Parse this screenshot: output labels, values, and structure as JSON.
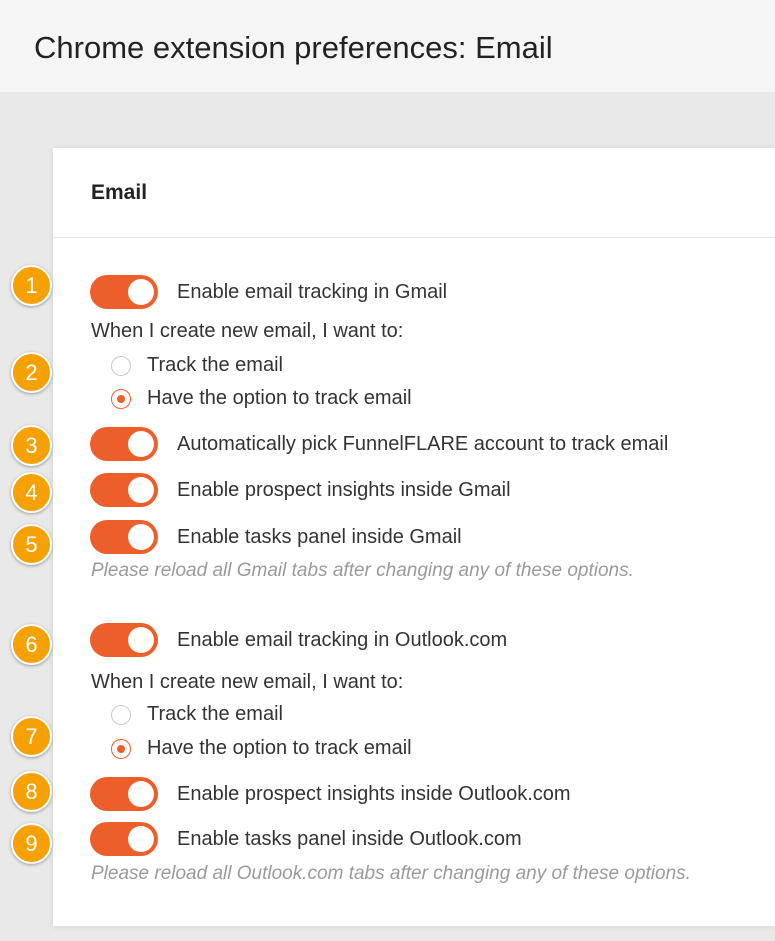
{
  "page": {
    "title": "Chrome extension preferences: Email"
  },
  "card": {
    "title": "Email",
    "gmail": {
      "enable_tracking": "Enable email tracking in Gmail",
      "prompt": "When I create new email, I want to:",
      "radio_track": "Track the email",
      "radio_option": "Have the option to track email",
      "auto_pick": "Automatically pick FunnelFLARE account to track email",
      "prospect_insights": "Enable prospect insights inside Gmail",
      "tasks_panel": "Enable tasks panel inside Gmail",
      "note": "Please reload all Gmail tabs after changing any of these options."
    },
    "outlook": {
      "enable_tracking": "Enable email tracking in Outlook.com",
      "prompt": "When I create new email, I want to:",
      "radio_track": "Track the email",
      "radio_option": "Have the option to track email",
      "prospect_insights": "Enable prospect insights inside Outlook.com",
      "tasks_panel": "Enable tasks panel inside Outlook.com",
      "note": "Please reload all Outlook.com tabs after changing any of these options."
    }
  },
  "badges": [
    "1",
    "2",
    "3",
    "4",
    "5",
    "6",
    "7",
    "8",
    "9"
  ],
  "colors": {
    "accent": "#ed5f2a",
    "badge": "#f7a100"
  }
}
